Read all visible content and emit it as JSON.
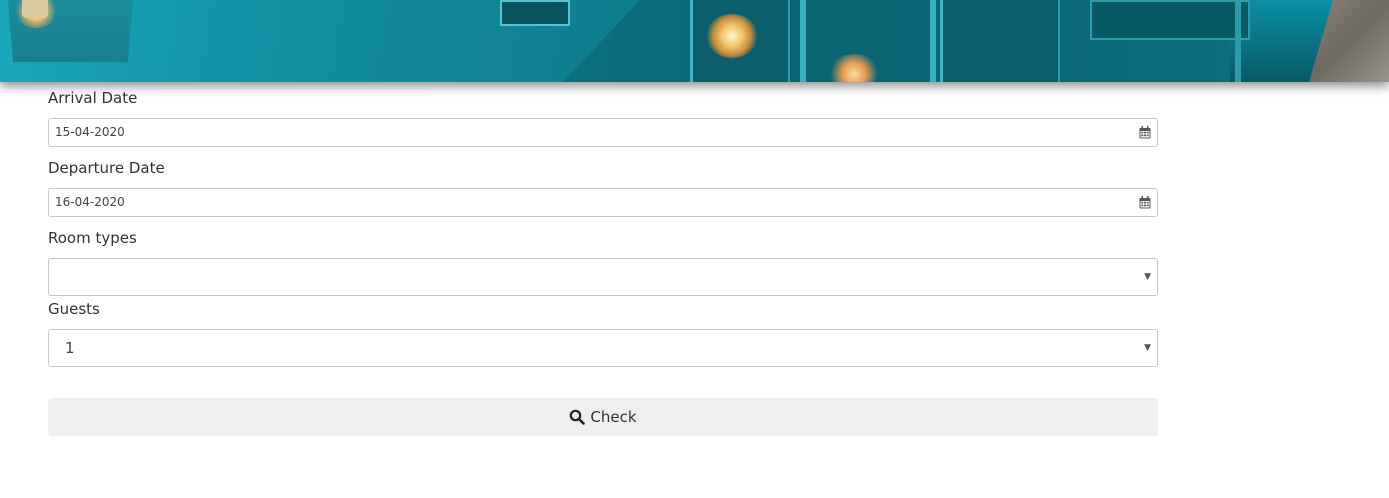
{
  "hero": {
    "image": "hotel-corridor-banner",
    "accent": "#0a6f80"
  },
  "form": {
    "arrival": {
      "label": "Arrival Date",
      "value": "15-04-2020",
      "icon": "calendar-icon"
    },
    "departure": {
      "label": "Departure Date",
      "value": "16-04-2020",
      "icon": "calendar-icon"
    },
    "room_types": {
      "label": "Room types",
      "value": "",
      "icon": "caret-down-icon"
    },
    "guests": {
      "label": "Guests",
      "value": "1",
      "icon": "caret-down-icon"
    },
    "check_button": {
      "label": "Check",
      "icon": "search-icon"
    }
  },
  "colors": {
    "button_bg": "#efefef",
    "border": "#c7c7c7",
    "text": "#333333"
  }
}
